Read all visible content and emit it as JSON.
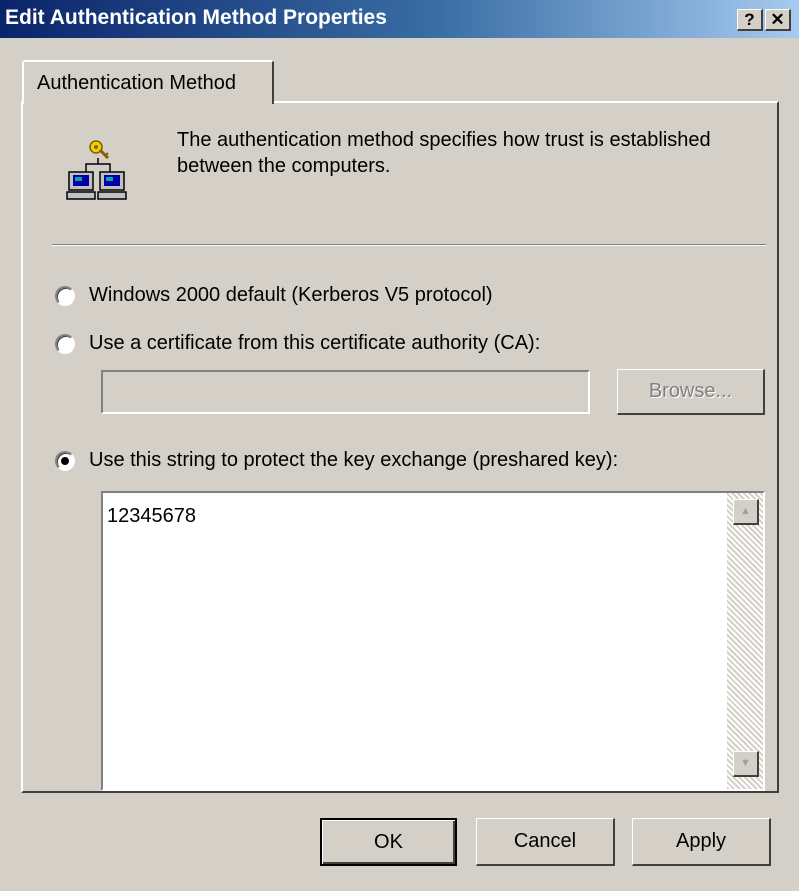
{
  "window": {
    "title": "Edit Authentication Method Properties",
    "help_label": "?",
    "close_label": "✕"
  },
  "tab": {
    "label": "Authentication Method"
  },
  "icon": {
    "name": "network-key-icon"
  },
  "description": "The authentication method specifies how trust is established between the computers.",
  "options": [
    {
      "label": "Windows 2000 default (Kerberos V5 protocol)",
      "checked": false
    },
    {
      "label": "Use a certificate from this certificate authority (CA):",
      "checked": false
    },
    {
      "label": "Use this string to protect the key exchange (preshared key):",
      "checked": true
    }
  ],
  "ca": {
    "value": "",
    "browse_label": "Browse...",
    "enabled": false
  },
  "preshared_key": {
    "value": "12345678"
  },
  "buttons": {
    "ok": "OK",
    "cancel": "Cancel",
    "apply": "Apply"
  },
  "colors": {
    "title_start": "#0a246a",
    "title_end": "#a6caf0",
    "face": "#d4d0c8"
  }
}
